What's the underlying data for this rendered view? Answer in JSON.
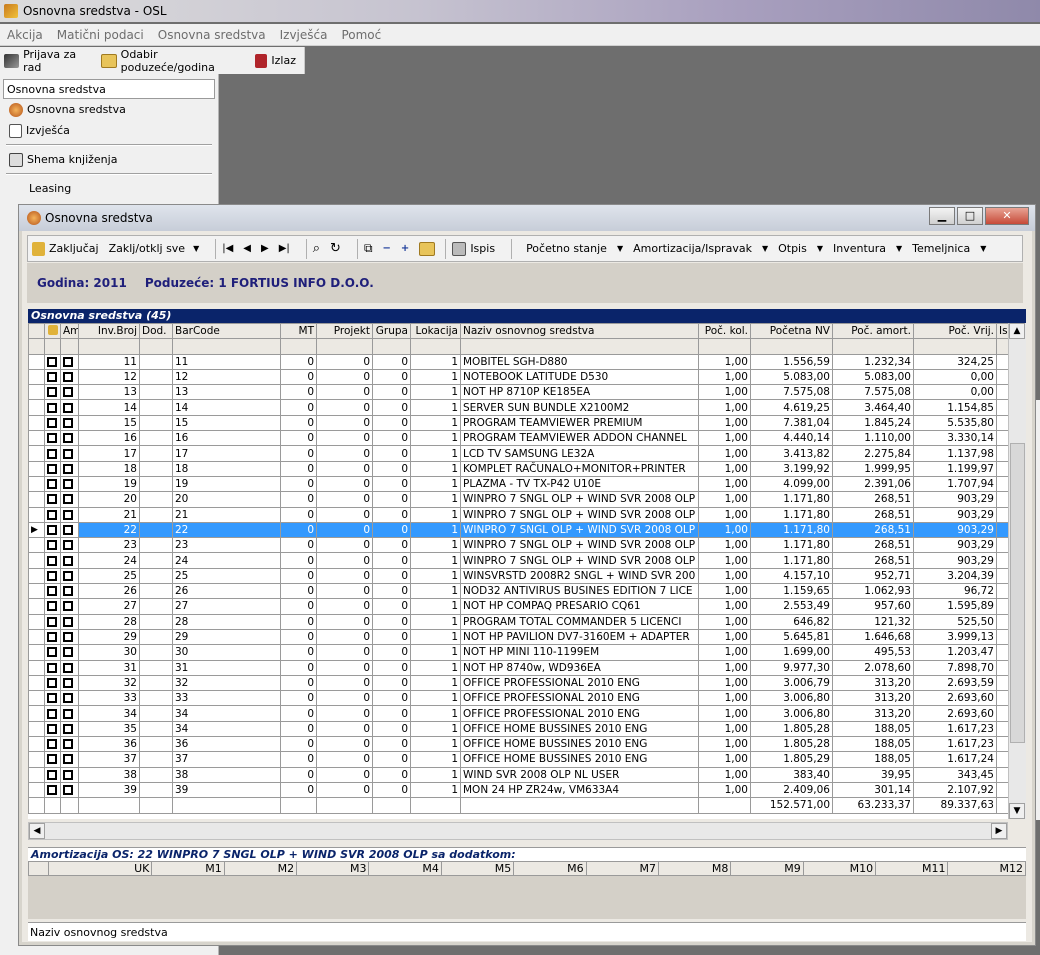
{
  "app": {
    "title": "Osnovna sredstva - OSL"
  },
  "menu": [
    "Akcija",
    "Matični podaci",
    "Osnovna sredstva",
    "Izvješća",
    "Pomoć"
  ],
  "toolbar": {
    "login": "Prijava za rad",
    "select": "Odabir poduzeće/godina",
    "exit": "Izlaz"
  },
  "left": {
    "header": "Osnovna sredstva",
    "items": [
      "Osnovna sredstva",
      "Izvješća",
      "Shema knjiženja",
      "Leasing"
    ]
  },
  "child": {
    "title": "Osnovna sredstva",
    "tools": {
      "lock": "Zaključaj",
      "lockall": "Zaklj/otklj sve",
      "print": "Ispis",
      "start": "Početno stanje",
      "amort": "Amortizacija/Ispravak",
      "otpis": "Otpis",
      "inv": "Inventura",
      "tem": "Temeljnica"
    },
    "godina": "Godina: 2011",
    "poduzece": "Poduzeće: 1 FORTIUS INFO D.O.O."
  },
  "grid": {
    "caption": "Osnovna sredstva (45)",
    "columns": [
      "Am",
      "Inv.Broj",
      "Dod.",
      "BarCode",
      "MT",
      "Projekt",
      "Grupa",
      "Lokacija",
      "Naziv osnovnog sredstva",
      "Poč. kol.",
      "Početna NV",
      "Poč. amort.",
      "Poč. Vrij.",
      "Ispr.\\"
    ],
    "rows": [
      [
        "11",
        "11",
        "0",
        "0",
        "0",
        "1",
        "MOBITEL SGH-D880",
        "1,00",
        "1.556,59",
        "1.232,34",
        "324,25"
      ],
      [
        "12",
        "12",
        "0",
        "0",
        "0",
        "1",
        "NOTEBOOK LATITUDE D530",
        "1,00",
        "5.083,00",
        "5.083,00",
        "0,00"
      ],
      [
        "13",
        "13",
        "0",
        "0",
        "0",
        "1",
        "NOT HP 8710P KE185EA",
        "1,00",
        "7.575,08",
        "7.575,08",
        "0,00"
      ],
      [
        "14",
        "14",
        "0",
        "0",
        "0",
        "1",
        "SERVER SUN BUNDLE X2100M2",
        "1,00",
        "4.619,25",
        "3.464,40",
        "1.154,85"
      ],
      [
        "15",
        "15",
        "0",
        "0",
        "0",
        "1",
        "PROGRAM TEAMVIEWER PREMIUM",
        "1,00",
        "7.381,04",
        "1.845,24",
        "5.535,80"
      ],
      [
        "16",
        "16",
        "0",
        "0",
        "0",
        "1",
        "PROGRAM TEAMVIEWER ADDON CHANNEL",
        "1,00",
        "4.440,14",
        "1.110,00",
        "3.330,14"
      ],
      [
        "17",
        "17",
        "0",
        "0",
        "0",
        "1",
        "LCD TV SAMSUNG LE32A",
        "1,00",
        "3.413,82",
        "2.275,84",
        "1.137,98"
      ],
      [
        "18",
        "18",
        "0",
        "0",
        "0",
        "1",
        "KOMPLET RAČUNALO+MONITOR+PRINTER",
        "1,00",
        "3.199,92",
        "1.999,95",
        "1.199,97"
      ],
      [
        "19",
        "19",
        "0",
        "0",
        "0",
        "1",
        "PLAZMA - TV TX-P42 U10E",
        "1,00",
        "4.099,00",
        "2.391,06",
        "1.707,94"
      ],
      [
        "20",
        "20",
        "0",
        "0",
        "0",
        "1",
        "WINPRO 7 SNGL OLP + WIND SVR 2008 OLP",
        "1,00",
        "1.171,80",
        "268,51",
        "903,29"
      ],
      [
        "21",
        "21",
        "0",
        "0",
        "0",
        "1",
        "WINPRO 7 SNGL OLP + WIND SVR 2008 OLP",
        "1,00",
        "1.171,80",
        "268,51",
        "903,29"
      ],
      [
        "22",
        "22",
        "0",
        "0",
        "0",
        "1",
        "WINPRO 7 SNGL OLP + WIND SVR 2008 OLP",
        "1,00",
        "1.171,80",
        "268,51",
        "903,29"
      ],
      [
        "23",
        "23",
        "0",
        "0",
        "0",
        "1",
        "WINPRO 7 SNGL OLP + WIND SVR 2008 OLP",
        "1,00",
        "1.171,80",
        "268,51",
        "903,29"
      ],
      [
        "24",
        "24",
        "0",
        "0",
        "0",
        "1",
        "WINPRO 7 SNGL OLP + WIND SVR 2008 OLP",
        "1,00",
        "1.171,80",
        "268,51",
        "903,29"
      ],
      [
        "25",
        "25",
        "0",
        "0",
        "0",
        "1",
        "WINSVRSTD 2008R2 SNGL + WIND SVR 200",
        "1,00",
        "4.157,10",
        "952,71",
        "3.204,39"
      ],
      [
        "26",
        "26",
        "0",
        "0",
        "0",
        "1",
        "NOD32 ANTIVIRUS BUSINES EDITION 7 LICE",
        "1,00",
        "1.159,65",
        "1.062,93",
        "96,72"
      ],
      [
        "27",
        "27",
        "0",
        "0",
        "0",
        "1",
        "NOT HP COMPAQ PRESARIO CQ61",
        "1,00",
        "2.553,49",
        "957,60",
        "1.595,89"
      ],
      [
        "28",
        "28",
        "0",
        "0",
        "0",
        "1",
        "PROGRAM TOTAL COMMANDER 5 LICENCI",
        "1,00",
        "646,82",
        "121,32",
        "525,50"
      ],
      [
        "29",
        "29",
        "0",
        "0",
        "0",
        "1",
        "NOT HP PAVILION DV7-3160EM + ADAPTER",
        "1,00",
        "5.645,81",
        "1.646,68",
        "3.999,13"
      ],
      [
        "30",
        "30",
        "0",
        "0",
        "0",
        "1",
        "NOT HP MINI 110-1199EM",
        "1,00",
        "1.699,00",
        "495,53",
        "1.203,47"
      ],
      [
        "31",
        "31",
        "0",
        "0",
        "0",
        "1",
        "NOT HP 8740w, WD936EA",
        "1,00",
        "9.977,30",
        "2.078,60",
        "7.898,70"
      ],
      [
        "32",
        "32",
        "0",
        "0",
        "0",
        "1",
        "OFFICE PROFESSIONAL 2010 ENG",
        "1,00",
        "3.006,79",
        "313,20",
        "2.693,59"
      ],
      [
        "33",
        "33",
        "0",
        "0",
        "0",
        "1",
        "OFFICE PROFESSIONAL 2010 ENG",
        "1,00",
        "3.006,80",
        "313,20",
        "2.693,60"
      ],
      [
        "34",
        "34",
        "0",
        "0",
        "0",
        "1",
        "OFFICE PROFESSIONAL 2010 ENG",
        "1,00",
        "3.006,80",
        "313,20",
        "2.693,60"
      ],
      [
        "35",
        "34",
        "0",
        "0",
        "0",
        "1",
        "OFFICE HOME BUSSINES 2010 ENG",
        "1,00",
        "1.805,28",
        "188,05",
        "1.617,23"
      ],
      [
        "36",
        "36",
        "0",
        "0",
        "0",
        "1",
        "OFFICE HOME BUSSINES 2010 ENG",
        "1,00",
        "1.805,28",
        "188,05",
        "1.617,23"
      ],
      [
        "37",
        "37",
        "0",
        "0",
        "0",
        "1",
        "OFFICE HOME BUSSINES 2010 ENG",
        "1,00",
        "1.805,29",
        "188,05",
        "1.617,24"
      ],
      [
        "38",
        "38",
        "0",
        "0",
        "0",
        "1",
        "WIND SVR 2008 OLP NL USER",
        "1,00",
        "383,40",
        "39,95",
        "343,45"
      ],
      [
        "39",
        "39",
        "0",
        "0",
        "0",
        "1",
        "MON 24 HP ZR24w, VM633A4",
        "1,00",
        "2.409,06",
        "301,14",
        "2.107,92"
      ]
    ],
    "selected_index": 11,
    "totals": {
      "nv": "152.571,00",
      "amort": "63.233,37",
      "vrij": "89.337,63"
    }
  },
  "amort": {
    "caption": "Amortizacija OS: 22 WINPRO 7 SNGL OLP + WIND SVR 2008 OLP sa dodatkom:",
    "columns": [
      "UK",
      "M1",
      "M2",
      "M3",
      "M4",
      "M5",
      "M6",
      "M7",
      "M8",
      "M9",
      "M10",
      "M11",
      "M12"
    ]
  },
  "status": "Naziv osnovnog sredstva"
}
